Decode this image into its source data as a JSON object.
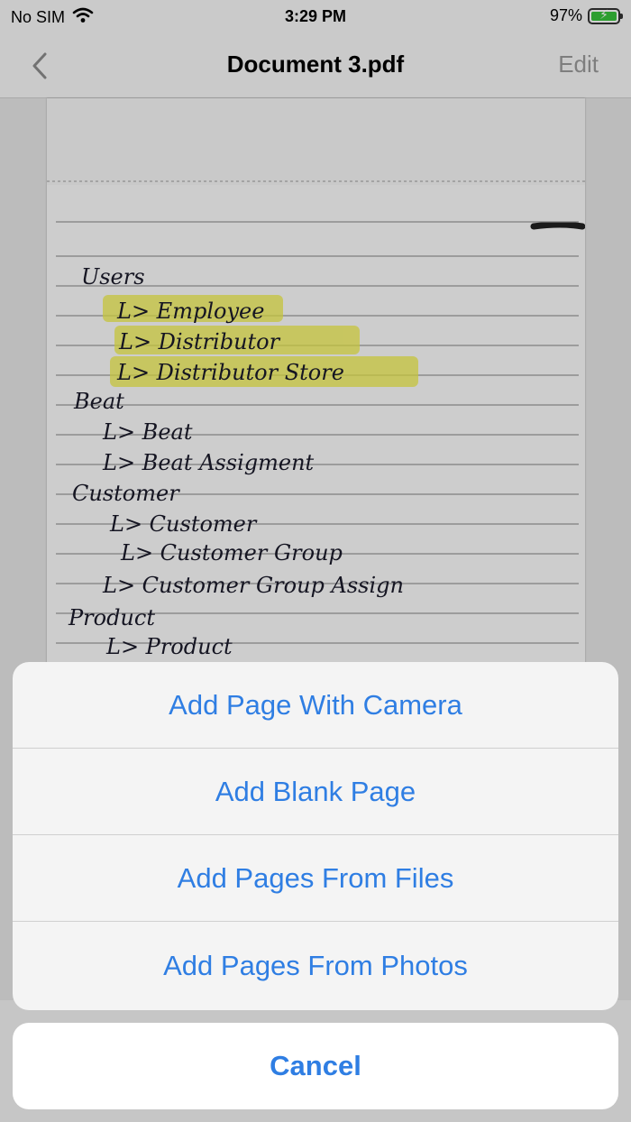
{
  "status_bar": {
    "carrier": "No SIM",
    "time": "3:29 PM",
    "battery_percent": "97%",
    "battery_level": 0.97,
    "wifi_icon": "wifi-icon",
    "battery_icon": "battery-charging-icon"
  },
  "nav": {
    "back_icon": "chevron-left-icon",
    "title": "Document 3.pdf",
    "edit_label": "Edit"
  },
  "document": {
    "handwritten_lines": [
      "Users",
      "L> Employee",
      "L> Distributor",
      "L> Distributor Store",
      "Beat",
      "L> Beat",
      "L> Beat Assigment",
      "Customer",
      "L> Customer",
      "L> Customer Group",
      "L> Customer Group Assign",
      "Product",
      "L> Product"
    ]
  },
  "action_sheet": {
    "items": [
      {
        "label": "Add Page With Camera"
      },
      {
        "label": "Add Blank Page"
      },
      {
        "label": "Add Pages From Files"
      },
      {
        "label": "Add Pages From Photos"
      }
    ],
    "cancel_label": "Cancel"
  },
  "colors": {
    "accent": "#2f7ee3",
    "highlight": "#f1ef4a"
  }
}
